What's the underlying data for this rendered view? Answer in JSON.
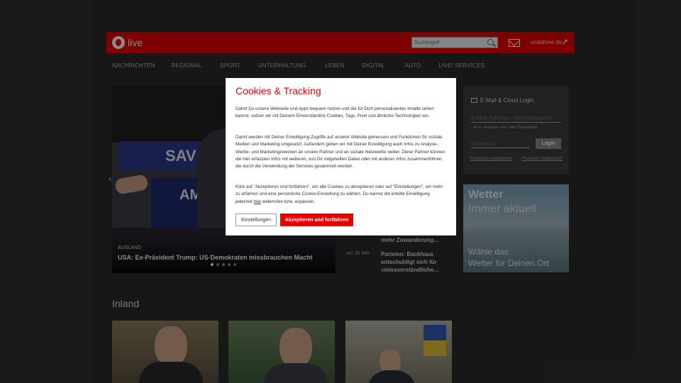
{
  "header": {
    "brand": "live",
    "search_placeholder": "Suchbegriff",
    "vodafone_link": "vodafone.de"
  },
  "nav": {
    "items": [
      "NACHRICHTEN",
      "REGIONAL",
      "SPORT",
      "UNTERHALTUNG",
      "LEBEN",
      "DIGITAL",
      "AUTO",
      "LIVE! SERVICES"
    ]
  },
  "hero": {
    "sign_text_1": "SAV",
    "sign_text_2": "AME",
    "category": "AUSLAND",
    "title": "USA: Ex-Präsident Trump: US-Demokraten missbrauchen Macht",
    "slide_count": 5,
    "active_slide": 1
  },
  "news": {
    "item1": "mehr Zuwanderung...",
    "item2_time": "vor 35 Min.",
    "item2": "Parteien: Backhaus entschuldigt sich für «missverständliche..."
  },
  "login": {
    "title": "E-Mail & Cloud Login",
    "email_placeholder": "E-Mail-Adresse / Benutzername",
    "hint": "Arcor, Vodafone oder Kabel Deutschland",
    "password_placeholder": "Passwort",
    "button": "Login",
    "register": "Kostenlos registrieren!",
    "forgot": "Passwort vergessen?"
  },
  "weather": {
    "title_line1": "Wetter",
    "title_line2": "Immer aktuell",
    "sub_line1": "Wähle das",
    "sub_line2": "Wetter für Deinen Ort"
  },
  "section": {
    "inland": "Inland"
  },
  "modal": {
    "title": "Cookies & Tracking",
    "p1": "Damit Du unsere Webseite und Apps bequem nutzen und die für Dich personalisierten Inhalte sehen kannst, setzen wir mit Deinem Einverständnis Cookies, Tags, Pixel und ähnliche Technologien ein.",
    "p2": "Damit werden mit Deiner Einwilligung Zugriffe auf unserer Website gemessen und Funktionen für soziale Medien und Marketing umgesetzt. Außerdem geben wir mit Deiner Einwilligung auch Infos zu Analyse-, Werbe- und Marketingzwecken an unsere Partner und an soziale Netzwerke weiter. Diese Partner können die hier erfassten Infos mit weiteren, von Dir mitgeteilten Daten oder mit anderen Infos zusammenführen, die durch die Verwendung der Services gesammelt werden.",
    "p3_before": "Klick auf \"Akzeptieren und fortfahren\", um alle Cookies zu akzeptieren oder auf \"Einstellungen\", um mehr zu erfahren und eine persönliche Cookie-Einstellung zu wählen. Du kannst die erteilte Einwilligung jederzeit ",
    "p3_link": "hier",
    "p3_after": " widerrufen bzw. anpassen.",
    "settings_button": "Einstellungen",
    "accept_button": "Akzeptieren und fortfahren"
  },
  "colors": {
    "brand_red": "#e60000",
    "page_bg": "#2b2b2b"
  }
}
